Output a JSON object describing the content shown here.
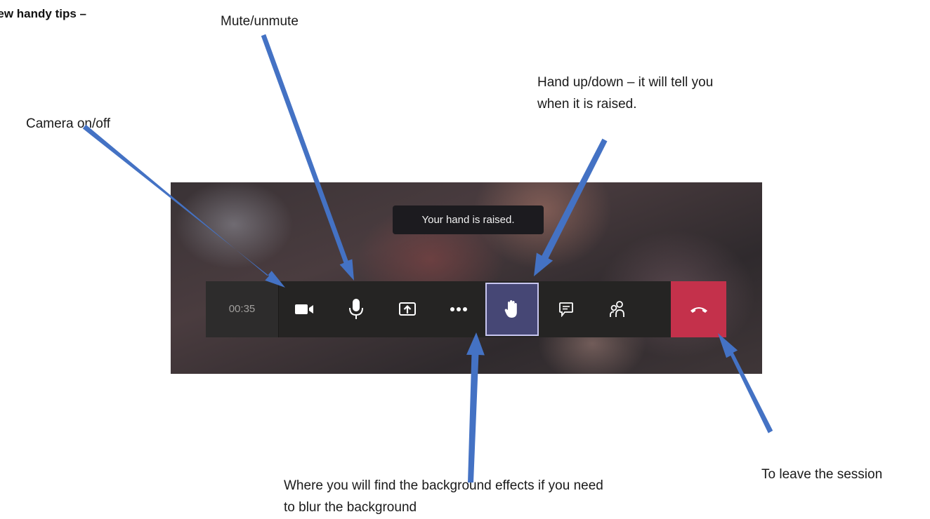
{
  "page": {
    "heading": "Few handy tips –"
  },
  "annotations": {
    "mute": "Mute/unmute",
    "camera": "Camera on/off",
    "hand": "Hand up/down – it will tell you when it is raised.",
    "leave": "To leave the session",
    "more": "Where you will find the background effects if you need to blur the background"
  },
  "meeting": {
    "tooltip": "Your hand is raised.",
    "timer": "00:35",
    "buttons": [
      {
        "name": "camera",
        "icon": "video-camera-icon"
      },
      {
        "name": "microphone",
        "icon": "microphone-icon"
      },
      {
        "name": "share",
        "icon": "share-screen-icon"
      },
      {
        "name": "more",
        "icon": "more-options-icon"
      },
      {
        "name": "raise-hand",
        "icon": "hand-icon",
        "active": true
      },
      {
        "name": "chat",
        "icon": "chat-icon"
      },
      {
        "name": "participants",
        "icon": "participants-icon"
      },
      {
        "name": "hang-up",
        "icon": "hang-up-icon"
      }
    ]
  },
  "colors": {
    "arrow": "#4472c4",
    "toolbar": "#252423",
    "hand_active": "#464775",
    "hang_up": "#c4314b"
  }
}
